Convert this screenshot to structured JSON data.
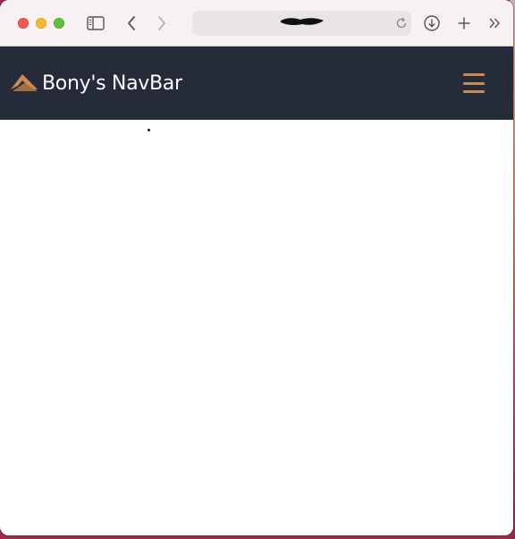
{
  "browser": {
    "address": {
      "url": ""
    },
    "icons": {
      "sidebar": "sidebar-icon",
      "back": "chevron-left-icon",
      "forward": "chevron-right-icon",
      "reload": "reload-icon",
      "download": "download-icon",
      "new_tab": "plus-icon",
      "more": "double-chevron-right-icon"
    }
  },
  "navbar": {
    "brand": "Bony's NavBar",
    "logo_icon": "bony-logo-icon",
    "menu_icon": "hamburger-menu-icon",
    "background_color": "#262b3a",
    "accent_color": "#c98a55"
  }
}
